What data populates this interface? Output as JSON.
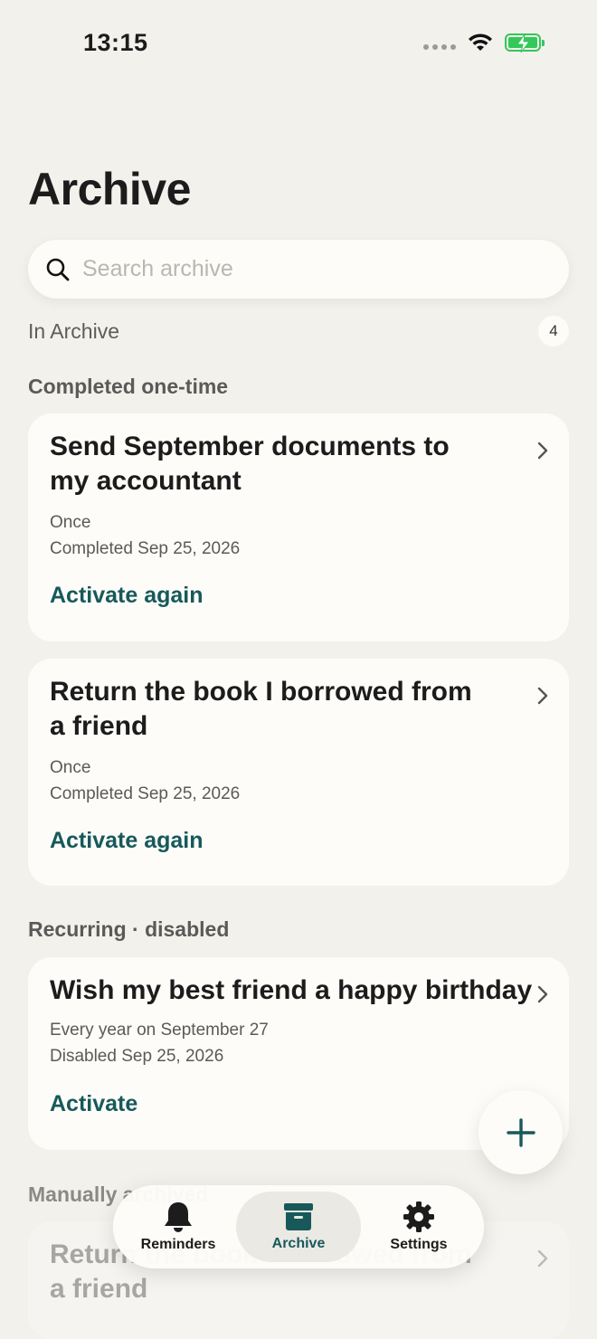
{
  "status_bar": {
    "time": "13:15"
  },
  "header": {
    "title": "Archive"
  },
  "search": {
    "placeholder": "Search archive"
  },
  "summary": {
    "label": "In Archive",
    "count": "4"
  },
  "sections": {
    "completed": {
      "title": "Completed one-time",
      "items": [
        {
          "title": "Send September documents to my accountant",
          "frequency": "Once",
          "status": "Completed Sep 25, 2026",
          "action": "Activate again"
        },
        {
          "title": "Return the book I borrowed from a friend",
          "frequency": "Once",
          "status": "Completed Sep 25, 2026",
          "action": "Activate again"
        }
      ]
    },
    "recurring": {
      "title": "Recurring · disabled",
      "items": [
        {
          "title": "Wish my best friend a happy birthday",
          "frequency": "Every year on September 27",
          "status": "Disabled Sep 25, 2026",
          "action": "Activate"
        }
      ]
    },
    "manual": {
      "title": "Manually archived",
      "items": [
        {
          "title": "Return the book I borrowed from a friend"
        }
      ]
    }
  },
  "tabbar": {
    "tabs": [
      {
        "label": "Reminders",
        "icon": "bell-icon"
      },
      {
        "label": "Archive",
        "icon": "archive-box-icon",
        "active": true
      },
      {
        "label": "Settings",
        "icon": "gear-icon"
      }
    ]
  },
  "colors": {
    "accent": "#17595b",
    "background": "#f3f1ec",
    "card": "#fdfcf8"
  }
}
